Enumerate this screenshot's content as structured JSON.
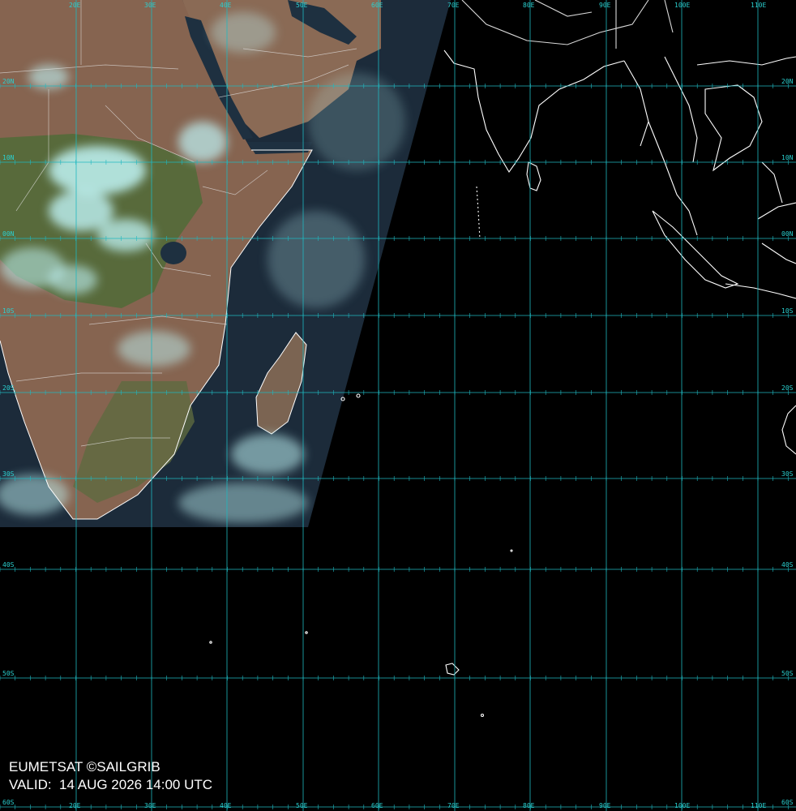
{
  "map": {
    "longitudes": [
      {
        "label": "20E"
      },
      {
        "label": "30E"
      },
      {
        "label": "40E"
      },
      {
        "label": "50E"
      },
      {
        "label": "60E"
      },
      {
        "label": "70E"
      },
      {
        "label": "80E"
      },
      {
        "label": "90E"
      },
      {
        "label": "100E"
      },
      {
        "label": "110E"
      }
    ],
    "latitudes": [
      {
        "label": "20N"
      },
      {
        "label": "10N"
      },
      {
        "label": "00N"
      },
      {
        "label": "10S"
      },
      {
        "label": "20S"
      },
      {
        "label": "30S"
      },
      {
        "label": "40S"
      },
      {
        "label": "50S"
      },
      {
        "label": "60S"
      }
    ],
    "colors": {
      "grid": "#1fb8c0",
      "coastline": "#ffffff",
      "ocean": "#1c2b3a",
      "land": "#8a6a55",
      "vegetation": "#556b3a",
      "cloud": "#bff4f6"
    }
  },
  "caption": {
    "line1": "EUMETSAT ©SAILGRIB",
    "line2": "VALID:  14 AUG 2026 14:00 UTC"
  }
}
